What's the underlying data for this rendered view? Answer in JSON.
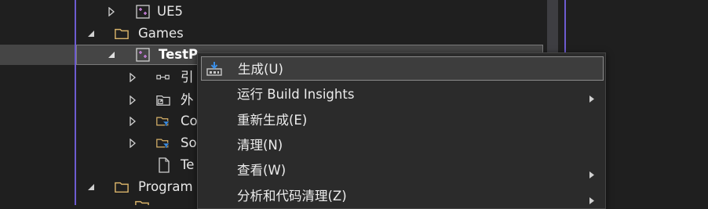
{
  "tree": {
    "items": [
      {
        "label": "UE5",
        "icon": "cpp-project-icon"
      },
      {
        "label": "Games",
        "icon": "folder-icon"
      },
      {
        "label": "TestP",
        "icon": "cpp-project-icon",
        "selected": true
      },
      {
        "label": "引",
        "icon": "references-icon"
      },
      {
        "label": "外",
        "icon": "external-deps-icon"
      },
      {
        "label": "Co",
        "icon": "filter-folder-icon"
      },
      {
        "label": "So",
        "icon": "filter-folder-icon"
      },
      {
        "label": "Te",
        "icon": "file-icon"
      },
      {
        "label": "Program",
        "icon": "folder-icon"
      }
    ]
  },
  "context_menu": {
    "items": [
      {
        "label": "生成(U)",
        "icon": "build-icon",
        "highlighted": true,
        "submenu": false
      },
      {
        "label": "运行 Build Insights",
        "submenu": true
      },
      {
        "label": "重新生成(E)",
        "submenu": false
      },
      {
        "label": "清理(N)",
        "submenu": false
      },
      {
        "label": "查看(W)",
        "submenu": true
      },
      {
        "label": "分析和代码清理(Z)",
        "submenu": true
      }
    ]
  },
  "colors": {
    "background": "#1f1f1f",
    "accent_frame": "#6d5bd0",
    "selection": "#454545",
    "menu_background": "#2b2b2b",
    "folder": "#d9b36a",
    "project_icon": "#c27bd4",
    "filter_funnel": "#3a8ee6"
  }
}
